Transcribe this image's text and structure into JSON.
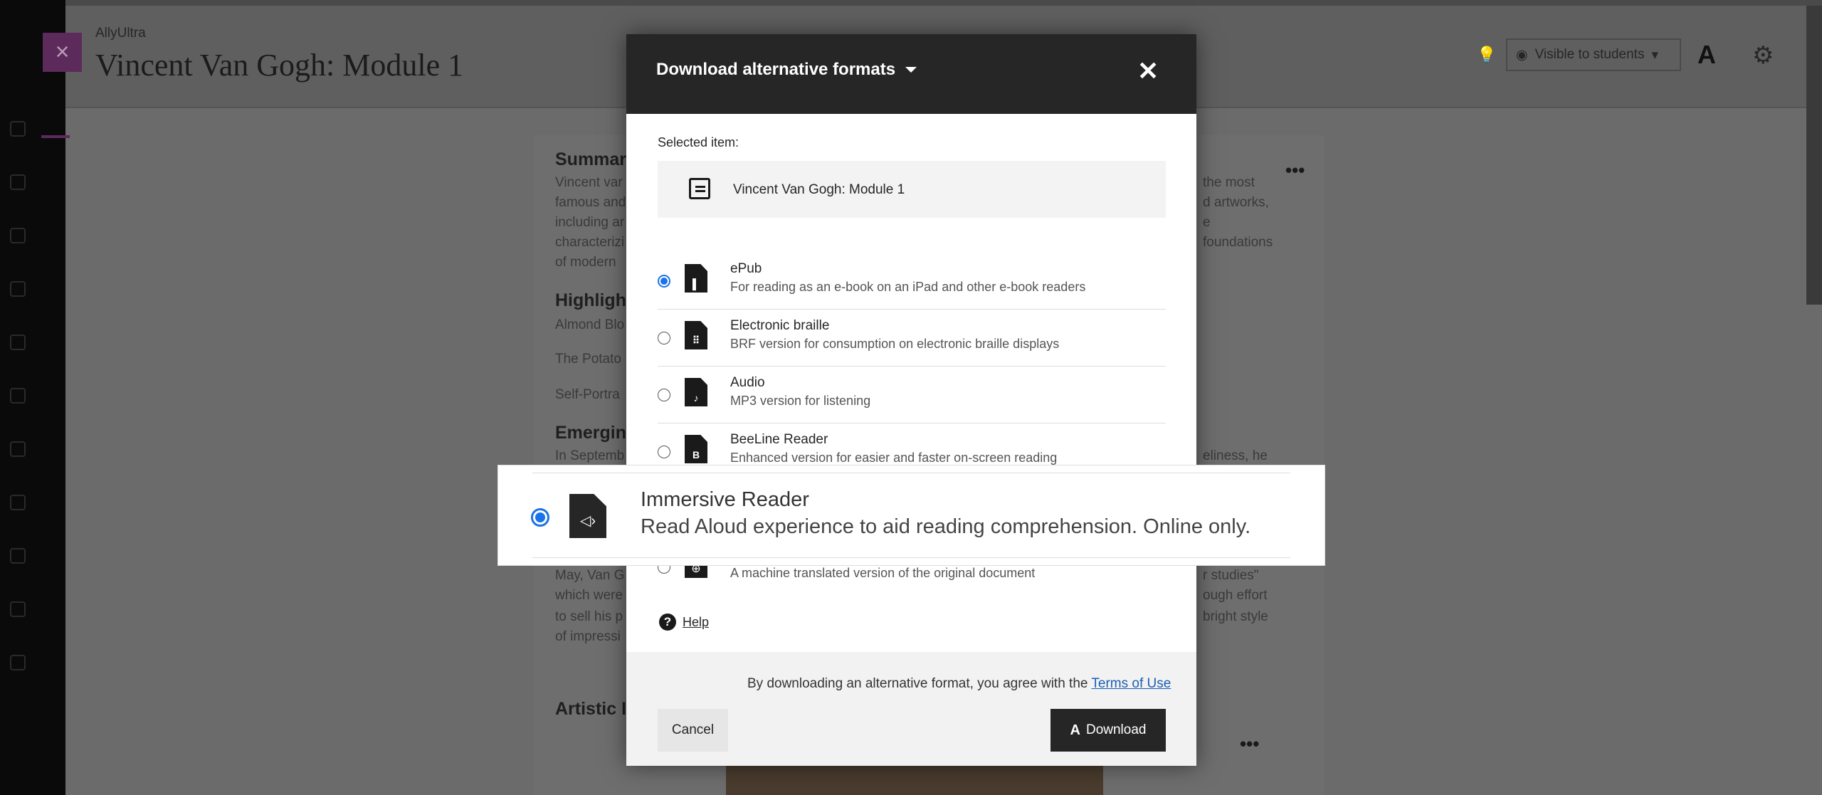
{
  "app": {
    "name": "AllyUltra",
    "title": "Vincent Van Gogh: Module 1",
    "close_glyph": "×"
  },
  "header": {
    "visibility_label": "Visible to students",
    "visibility_caret": "▾",
    "eye_glyph": "◉",
    "bulb_glyph": "💡",
    "gear_glyph": "⚙",
    "ally_glyph": "A"
  },
  "background": {
    "summary_heading": "Summar",
    "summary_lines": [
      "Vincent var",
      "famous and",
      "including ar",
      "characterizi",
      "of modern"
    ],
    "summary_right": [
      "the most",
      "d artworks,",
      "e",
      "foundations"
    ],
    "highlights_heading": "Highligh",
    "highlights_items": [
      "Almond Blo",
      "The Potato",
      "Self-Portra"
    ],
    "emerging_heading": "Emergin",
    "emerging_line": "In Septemb",
    "emerging_right": "eliness, he",
    "para_lines": [
      "May, Van G",
      "which were",
      "to sell his p",
      "of impressi"
    ],
    "para_right": [
      "r studies\"",
      "ough effort",
      "bright style"
    ],
    "artistic_heading": "Artistic I",
    "more_glyph": "•••"
  },
  "modal": {
    "title": "Download alternative formats",
    "close_glyph": "✕",
    "selected_label": "Selected item:",
    "selected_item": "Vincent Van Gogh: Module 1",
    "options": [
      {
        "title": "ePub",
        "desc": "For reading as an e-book on an iPad and other e-book readers",
        "icon": "▌",
        "selected": true
      },
      {
        "title": "Electronic braille",
        "desc": "BRF version for consumption on electronic braille displays",
        "icon": "⠿",
        "selected": false
      },
      {
        "title": "Audio",
        "desc": "MP3 version for listening",
        "icon": "♪",
        "selected": false
      },
      {
        "title": "BeeLine Reader",
        "desc": "Enhanced version for easier and faster on-screen reading",
        "icon": "B",
        "selected": false
      }
    ],
    "zoom_option": {
      "title": "Immersive Reader",
      "desc": "Read Aloud experience to aid reading comprehension. Online only.",
      "icon": "◁›"
    },
    "translated_desc": "A machine translated version of the original document",
    "translated_icon": "⊕",
    "help_glyph": "?",
    "help_label": "Help",
    "terms_text": "By downloading an alternative format, you agree with the",
    "terms_link": "Terms of Use",
    "cancel_label": "Cancel",
    "download_label": "Download",
    "download_glyph": "A"
  }
}
